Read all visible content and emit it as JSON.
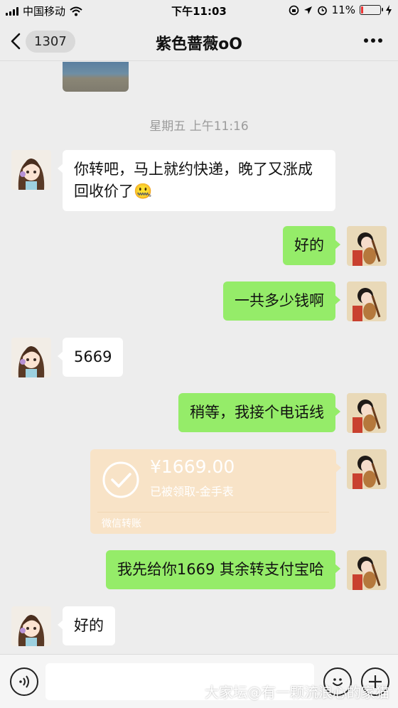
{
  "status_bar": {
    "carrier": "中国移动",
    "time": "下午11:03",
    "battery_percent": "11%",
    "battery_level": 0.11,
    "icons": [
      "signal-icon",
      "wifi-icon",
      "rotation-lock-icon",
      "location-icon",
      "alarm-icon",
      "battery-icon",
      "charging-icon"
    ]
  },
  "nav": {
    "back_count": "1307",
    "title": "紫色蔷薇oO",
    "more_icon": "more-icon"
  },
  "chat": {
    "timestamp": "星期五 上午11:16",
    "messages": [
      {
        "from": "contact",
        "text": "你转吧，马上就约快递，晚了又涨成回收价了🤐"
      },
      {
        "from": "me",
        "text": "好的"
      },
      {
        "from": "me",
        "text": "一共多少钱啊"
      },
      {
        "from": "contact",
        "text": "5669"
      },
      {
        "from": "me",
        "text": "稍等，我接个电话线"
      },
      {
        "from": "me",
        "type": "transfer"
      },
      {
        "from": "me",
        "text": "我先给你1669  其余转支付宝哈"
      },
      {
        "from": "contact",
        "text": "好的"
      }
    ]
  },
  "transfer": {
    "amount": "¥1669.00",
    "note": "已被领取-金手表",
    "brand": "微信转账"
  },
  "input_bar": {
    "voice_icon": "voice-icon",
    "emoji_icon": "emoji-icon",
    "plus_icon": "plus-icon",
    "placeholder": ""
  },
  "watermark": "大家坛@有一颗流浪心的家猫",
  "colors": {
    "background": "#ededed",
    "outgoing_bubble": "#95ec69",
    "incoming_bubble": "#ffffff",
    "transfer_received": "#f8e3c7"
  }
}
